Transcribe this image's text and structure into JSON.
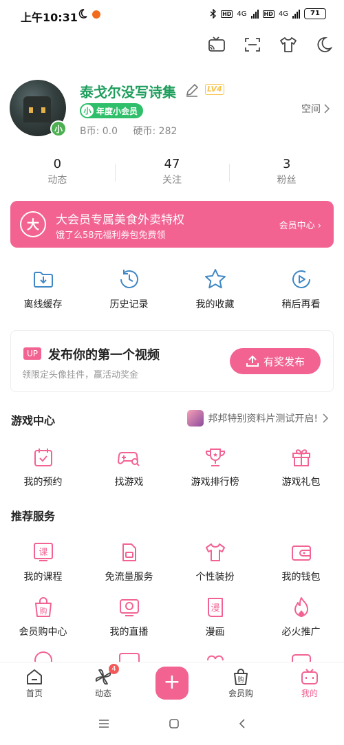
{
  "status": {
    "time": "上午10:31",
    "hd1": "HD",
    "hd2": "HD",
    "net1": "4G",
    "net2": "4G",
    "battery": "71"
  },
  "profile": {
    "name": "泰戈尔没写诗集",
    "level": "LV4",
    "vip_label": "年度小会员",
    "vip_short": "小",
    "avatar_badge": "小",
    "bcoin": "B币: 0.0",
    "coin": "硬币: 282",
    "space": "空间"
  },
  "stats": [
    {
      "num": "0",
      "label": "动态"
    },
    {
      "num": "47",
      "label": "关注"
    },
    {
      "num": "3",
      "label": "粉丝"
    }
  ],
  "banner": {
    "logo": "大",
    "title": "大会员专属美食外卖特权",
    "subtitle": "饿了么58元福利券包免费领",
    "link": "会员中心 ›"
  },
  "quick": [
    {
      "label": "离线缓存",
      "icon": "download-folder-icon"
    },
    {
      "label": "历史记录",
      "icon": "history-icon"
    },
    {
      "label": "我的收藏",
      "icon": "star-icon"
    },
    {
      "label": "稍后再看",
      "icon": "watch-later-icon"
    }
  ],
  "upload": {
    "tag": "UP",
    "title": "发布你的第一个视频",
    "subtitle": "领限定头像挂件，赢活动奖金",
    "button": "有奖发布"
  },
  "games": {
    "title": "游戏中心",
    "promo": "邦邦特别资料片测试开启!",
    "items": [
      {
        "label": "我的预约",
        "icon": "calendar-icon"
      },
      {
        "label": "找游戏",
        "icon": "gamepad-search-icon"
      },
      {
        "label": "游戏排行榜",
        "icon": "trophy-icon"
      },
      {
        "label": "游戏礼包",
        "icon": "gift-icon"
      }
    ]
  },
  "services": {
    "title": "推荐服务",
    "row1": [
      {
        "label": "我的课程",
        "icon": "course-icon"
      },
      {
        "label": "免流量服务",
        "icon": "sim-card-icon"
      },
      {
        "label": "个性装扮",
        "icon": "tshirt-icon"
      },
      {
        "label": "我的钱包",
        "icon": "wallet-icon"
      }
    ],
    "row2": [
      {
        "label": "会员购中心",
        "icon": "shopping-bag-icon"
      },
      {
        "label": "我的直播",
        "icon": "live-tv-icon"
      },
      {
        "label": "漫画",
        "icon": "comic-icon"
      },
      {
        "label": "必火推广",
        "icon": "fire-icon"
      }
    ]
  },
  "nav": [
    {
      "label": "首页",
      "icon": "home-icon"
    },
    {
      "label": "动态",
      "icon": "pinwheel-icon",
      "badge": "4"
    },
    {
      "label": "+",
      "icon": "plus-icon"
    },
    {
      "label": "会员购",
      "icon": "shopping-bag-icon"
    },
    {
      "label": "我的",
      "icon": "tv-mascot-icon"
    }
  ],
  "colors": {
    "accent": "#f26392",
    "vip_green": "#2fbf6a",
    "name_green": "#1e9e5d"
  }
}
